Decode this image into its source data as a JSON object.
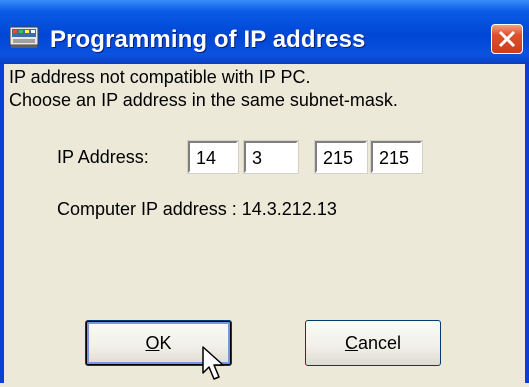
{
  "window": {
    "title": "Programming of IP address",
    "icon": "app-network-icon",
    "close_icon": "close-icon"
  },
  "message": {
    "line1": "IP address not compatible with IP PC.",
    "line2": "Choose an IP address in the same subnet-mask."
  },
  "ip_address": {
    "label": "IP Address:",
    "octets": [
      "14",
      "3",
      "215",
      "215"
    ]
  },
  "computer_ip": {
    "text": "Computer IP address : 14.3.212.13"
  },
  "buttons": {
    "ok_mnemonic": "O",
    "ok_rest": "K",
    "cancel_mnemonic": "C",
    "cancel_rest": "ancel"
  },
  "colors": {
    "titlebar": "#0046d5",
    "dialog_bg": "#ece9d8",
    "close_button": "#e0502c"
  }
}
